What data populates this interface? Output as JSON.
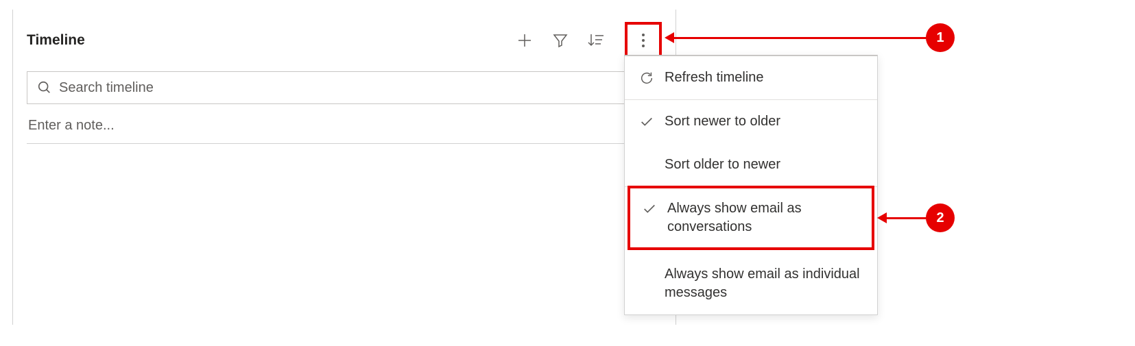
{
  "timeline": {
    "title": "Timeline",
    "search_placeholder": "Search timeline",
    "note_placeholder": "Enter a note..."
  },
  "menu": {
    "refresh": "Refresh timeline",
    "sort_newer": "Sort newer to older",
    "sort_older": "Sort older to newer",
    "email_conversations": "Always show email as conversations",
    "email_individual": "Always show email as individual messages"
  },
  "callouts": {
    "one": "1",
    "two": "2"
  }
}
